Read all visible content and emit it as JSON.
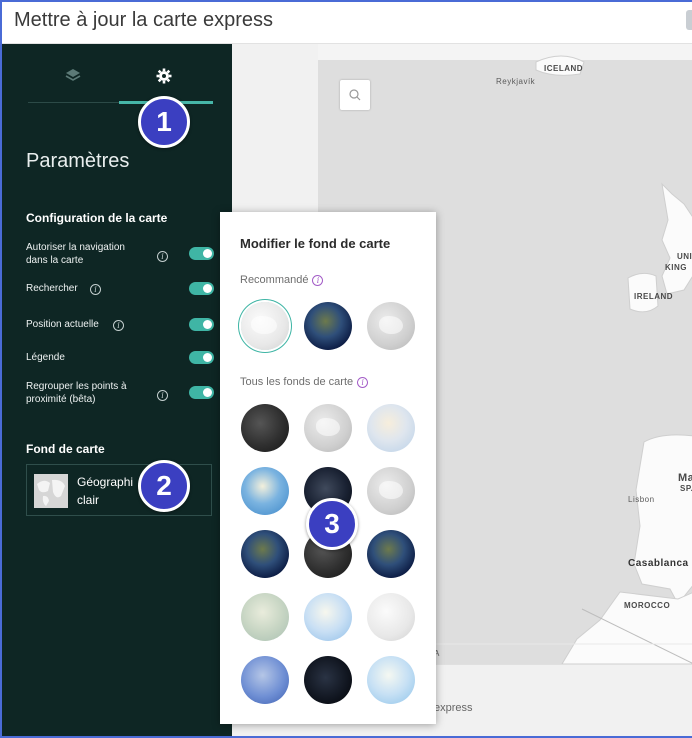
{
  "window": {
    "title": "Mettre à jour la carte express"
  },
  "sidebar": {
    "tabs": [
      {
        "icon": "layers-icon",
        "active": false
      },
      {
        "icon": "gear-icon",
        "active": true
      }
    ],
    "heading": "Paramètres",
    "section_title": "Configuration de la carte",
    "options": [
      {
        "label": "Autoriser la navigation dans la carte",
        "enabled": true,
        "info": true
      },
      {
        "label": "Rechercher",
        "enabled": true,
        "info": true
      },
      {
        "label": "Position actuelle",
        "enabled": true,
        "info": true
      },
      {
        "label": "Légende",
        "enabled": true,
        "info": false
      },
      {
        "label": "Regrouper les points à proximité (bêta)",
        "enabled": true,
        "info": true
      }
    ],
    "basemap_section_title": "Fond de carte",
    "basemap_current": "Géographie claire",
    "basemap_current_visible": "Géographi",
    "basemap_current_visible_tail": "e",
    "basemap_current_line2": "clair"
  },
  "basemap_popup": {
    "title": "Modifier le fond de carte",
    "recommended_label": "Recommandé",
    "all_label": "Tous les fonds de carte",
    "recommended": [
      "light-gray",
      "imagery",
      "gray"
    ],
    "all": [
      [
        "dark-gray",
        "gray",
        "streets"
      ],
      [
        "oceans",
        "night",
        "gray"
      ],
      [
        "imagery",
        "imagery-dark",
        "imagery"
      ],
      [
        "terrain",
        "pastel",
        "white"
      ],
      [
        "blue",
        "black",
        "ice"
      ]
    ]
  },
  "map": {
    "labels": {
      "iceland": "ICELAND",
      "reykjavik": "Reykjavík",
      "uk": "UNIT",
      "uk2": "KING",
      "ireland": "IRELAND",
      "spain": "Ma",
      "spain2": "SP.",
      "lisbon": "Lisbon",
      "casablanca": "Casablanca",
      "morocco": "MOROCCO",
      "attribution": "A"
    },
    "footer_text": "express"
  },
  "callouts": [
    "1",
    "2",
    "3"
  ],
  "colors": {
    "sidebar_bg": "#0e2624",
    "accent": "#3fb5a5",
    "callout": "#3b3fc1"
  }
}
